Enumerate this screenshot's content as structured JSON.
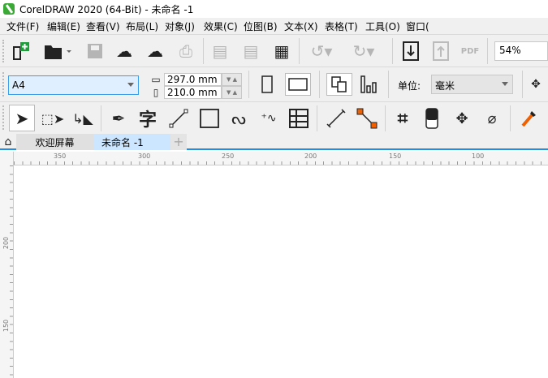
{
  "window": {
    "title": "CorelDRAW 2020 (64-Bit) - 未命名 -1"
  },
  "menu": [
    "文件(F)",
    "编辑(E)",
    "查看(V)",
    "布局(L)",
    "对象(J)",
    "效果(C)",
    "位图(B)",
    "文本(X)",
    "表格(T)",
    "工具(O)",
    "窗口("
  ],
  "toolbar": {
    "zoom": "54%",
    "pdf_label": "PDF"
  },
  "property_bar": {
    "page_size": "A4",
    "width": "297.0 mm",
    "height": "210.0 mm",
    "unit_label": "单位:",
    "unit_value": "毫米"
  },
  "tabs": [
    "欢迎屏幕",
    "未命名 -1"
  ],
  "ruler": {
    "top": [
      "350",
      "300",
      "250",
      "200",
      "150",
      "100"
    ],
    "left": [
      "200",
      "150"
    ]
  },
  "colors": {
    "accent": "#1e90e0",
    "active_tab": "#cde6ff"
  }
}
